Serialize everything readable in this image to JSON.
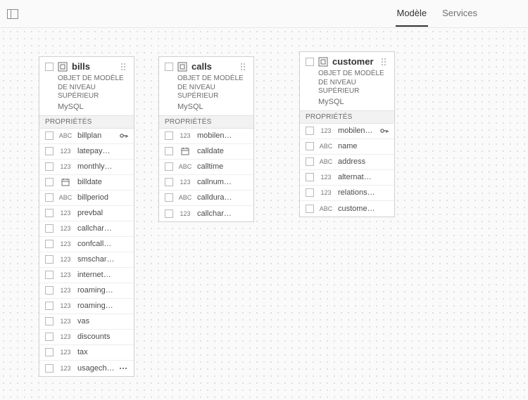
{
  "tabs": {
    "model": "Modèle",
    "services": "Services"
  },
  "labels": {
    "subtype": "OBJET DE MODÈLE DE NIVEAU SUPÉRIEUR",
    "source": "MySQL",
    "properties": "PROPRIÉTÉS"
  },
  "types": {
    "abc": "ABC",
    "num": "123"
  },
  "entities": {
    "bills": {
      "title": "bills",
      "props": [
        {
          "t": "abc",
          "n": "billplan",
          "key": true
        },
        {
          "t": "num",
          "n": "latepay…"
        },
        {
          "t": "num",
          "n": "monthly…"
        },
        {
          "t": "cal",
          "n": "billdate"
        },
        {
          "t": "abc",
          "n": "billperiod"
        },
        {
          "t": "num",
          "n": "prevbal"
        },
        {
          "t": "num",
          "n": "callchar…"
        },
        {
          "t": "num",
          "n": "confcall…"
        },
        {
          "t": "num",
          "n": "smschar…"
        },
        {
          "t": "num",
          "n": "internet…"
        },
        {
          "t": "num",
          "n": "roaming…"
        },
        {
          "t": "num",
          "n": "roaming…"
        },
        {
          "t": "num",
          "n": "vas"
        },
        {
          "t": "num",
          "n": "discounts"
        },
        {
          "t": "num",
          "n": "tax"
        },
        {
          "t": "num",
          "n": "usagech…",
          "more": true
        }
      ]
    },
    "calls": {
      "title": "calls",
      "props": [
        {
          "t": "num",
          "n": "mobilen…"
        },
        {
          "t": "cal",
          "n": "calldate"
        },
        {
          "t": "abc",
          "n": "calltime"
        },
        {
          "t": "num",
          "n": "callnum…"
        },
        {
          "t": "abc",
          "n": "calldura…"
        },
        {
          "t": "num",
          "n": "callchar…"
        }
      ]
    },
    "customer": {
      "title": "customer",
      "props": [
        {
          "t": "num",
          "n": "mobilen…",
          "key": true
        },
        {
          "t": "abc",
          "n": "name"
        },
        {
          "t": "abc",
          "n": "address"
        },
        {
          "t": "num",
          "n": "alternat…"
        },
        {
          "t": "num",
          "n": "relations…"
        },
        {
          "t": "abc",
          "n": "custome…"
        }
      ]
    }
  }
}
